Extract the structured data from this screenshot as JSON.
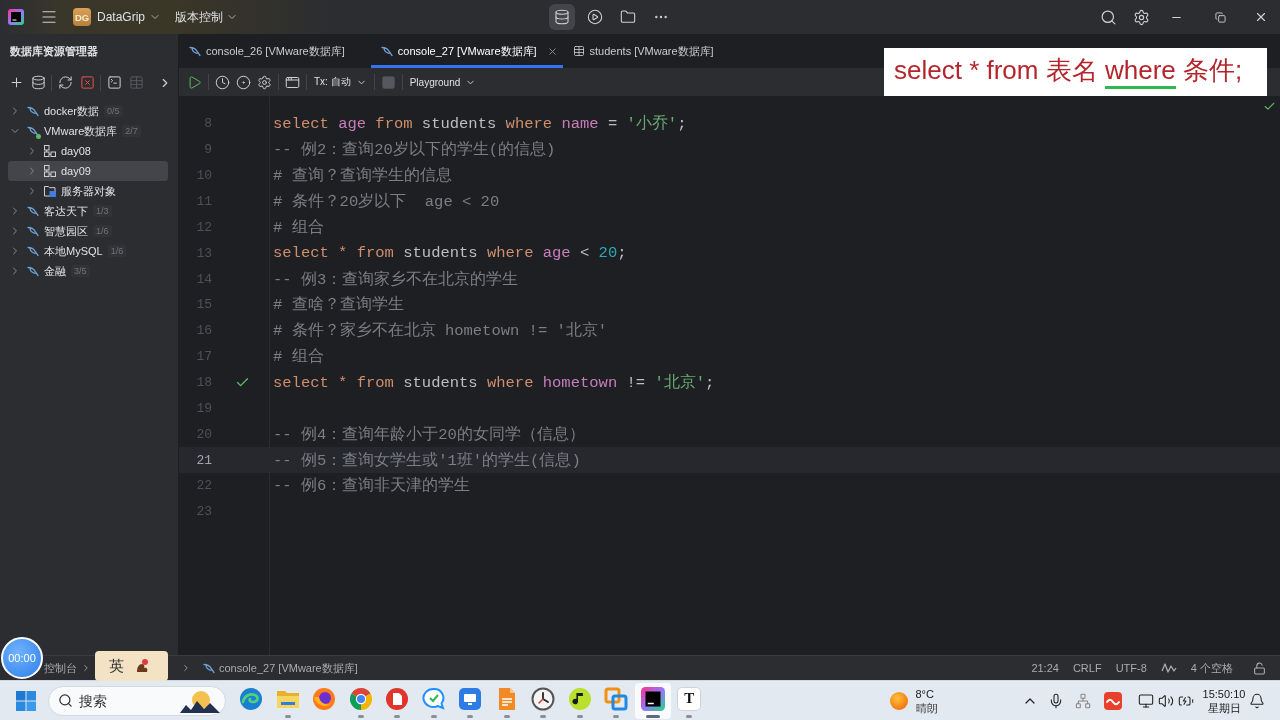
{
  "title_bar": {
    "project": {
      "badge": "DG",
      "name": "DataGrip"
    },
    "vcs_menu": "版本控制",
    "tools": [
      {
        "kind": "database",
        "selected": true
      },
      {
        "kind": "services",
        "selected": false
      },
      {
        "kind": "folder",
        "selected": false
      },
      {
        "kind": "more",
        "selected": false
      }
    ]
  },
  "sidebar": {
    "title": "数据库资源管理器",
    "toolbar": [
      [
        {
          "kind": "add",
          "disabled": false
        },
        {
          "kind": "datasource-settings",
          "disabled": false
        }
      ],
      [
        {
          "kind": "refresh",
          "disabled": false
        },
        {
          "kind": "disconnect",
          "disabled": false
        }
      ],
      [
        {
          "kind": "console",
          "disabled": false
        },
        {
          "kind": "table",
          "disabled": true
        }
      ]
    ],
    "tree": [
      {
        "label": "docker数据",
        "count": "0/5",
        "kind": "datasource",
        "connected": false,
        "expanded": false,
        "selected": false
      },
      {
        "label": "VMware数据库",
        "count": "2/7",
        "kind": "datasource",
        "connected": true,
        "expanded": true,
        "selected": false,
        "children": [
          {
            "label": "day08",
            "kind": "schema",
            "expanded": false,
            "selected": false
          },
          {
            "label": "day09",
            "kind": "schema",
            "expanded": false,
            "selected": true
          },
          {
            "label": "服务器对象",
            "kind": "folder",
            "expanded": false,
            "selected": false
          }
        ]
      },
      {
        "label": "客达天下",
        "count": "1/3",
        "kind": "datasource",
        "connected": false,
        "expanded": false,
        "selected": false
      },
      {
        "label": "智慧园区",
        "count": "1/6",
        "kind": "datasource",
        "connected": false,
        "expanded": false,
        "selected": false
      },
      {
        "label": "本地MySQL",
        "count": "1/6",
        "kind": "datasource",
        "connected": false,
        "expanded": false,
        "selected": false
      },
      {
        "label": "金融",
        "count": "3/5",
        "kind": "datasource",
        "connected": false,
        "expanded": false,
        "selected": false
      }
    ]
  },
  "tabs": [
    {
      "label": "console_26 [VMware数据库]",
      "kind": "console",
      "selected": false
    },
    {
      "label": "console_27 [VMware数据库]",
      "kind": "console",
      "selected": true
    },
    {
      "label": "students [VMware数据库]",
      "kind": "table",
      "selected": false
    }
  ],
  "editor_toolbar": [
    [
      {
        "kind": "run",
        "disabled": false
      }
    ],
    [
      {
        "kind": "history",
        "disabled": false
      },
      {
        "kind": "ddl",
        "disabled": false
      },
      {
        "kind": "settings",
        "disabled": false
      }
    ],
    [
      {
        "kind": "layout",
        "disabled": false
      }
    ],
    [
      {
        "kind": "dropdown",
        "label": "Tx: 自动"
      }
    ],
    [
      {
        "kind": "stop",
        "disabled": true
      }
    ],
    [
      {
        "kind": "dropdown",
        "label": "Playground"
      }
    ]
  ],
  "caption": [
    {
      "text": "select * from 表名 ",
      "underlined": false
    },
    {
      "text": "where",
      "underlined": true
    },
    {
      "text": " 条件;",
      "underlined": false
    }
  ],
  "editor": {
    "inspections_passed": true,
    "lines": [
      {
        "number": "8",
        "current": false,
        "executed": false,
        "tokens": [
          {
            "kind": "keyword",
            "text": "select "
          },
          {
            "kind": "column",
            "text": "age "
          },
          {
            "kind": "keyword",
            "text": "from "
          },
          {
            "kind": "plain",
            "text": "students "
          },
          {
            "kind": "keyword",
            "text": "where "
          },
          {
            "kind": "column",
            "text": "name "
          },
          {
            "kind": "plain",
            "text": "= "
          },
          {
            "kind": "string",
            "text": "'小乔'"
          },
          {
            "kind": "plain",
            "text": ";"
          }
        ]
      },
      {
        "number": "9",
        "current": false,
        "executed": false,
        "tokens": [
          {
            "kind": "comment",
            "text": "-- 例2：查询20岁以下的学生(的信息)"
          }
        ]
      },
      {
        "number": "10",
        "current": false,
        "executed": false,
        "tokens": [
          {
            "kind": "comment",
            "text": "# 查询？查询学生的信息"
          }
        ]
      },
      {
        "number": "11",
        "current": false,
        "executed": false,
        "tokens": [
          {
            "kind": "comment",
            "text": "# 条件？20岁以下  age < 20"
          }
        ]
      },
      {
        "number": "12",
        "current": false,
        "executed": false,
        "tokens": [
          {
            "kind": "comment",
            "text": "# 组合"
          }
        ]
      },
      {
        "number": "13",
        "current": false,
        "executed": false,
        "tokens": [
          {
            "kind": "keyword",
            "text": "select * from "
          },
          {
            "kind": "plain",
            "text": "students "
          },
          {
            "kind": "keyword",
            "text": "where "
          },
          {
            "kind": "column",
            "text": "age "
          },
          {
            "kind": "plain",
            "text": "< "
          },
          {
            "kind": "number",
            "text": "20"
          },
          {
            "kind": "plain",
            "text": ";"
          }
        ]
      },
      {
        "number": "14",
        "current": false,
        "executed": false,
        "tokens": [
          {
            "kind": "comment",
            "text": "-- 例3：查询家乡不在北京的学生"
          }
        ]
      },
      {
        "number": "15",
        "current": false,
        "executed": false,
        "tokens": [
          {
            "kind": "comment",
            "text": "# 查啥？查询学生"
          }
        ]
      },
      {
        "number": "16",
        "current": false,
        "executed": false,
        "tokens": [
          {
            "kind": "comment",
            "text": "# 条件？家乡不在北京 hometown != '北京'"
          }
        ]
      },
      {
        "number": "17",
        "current": false,
        "executed": false,
        "tokens": [
          {
            "kind": "comment",
            "text": "# 组合"
          }
        ]
      },
      {
        "number": "18",
        "current": false,
        "executed": true,
        "tokens": [
          {
            "kind": "keyword",
            "text": "select * from "
          },
          {
            "kind": "plain",
            "text": "students "
          },
          {
            "kind": "keyword",
            "text": "where "
          },
          {
            "kind": "column",
            "text": "hometown "
          },
          {
            "kind": "plain",
            "text": "!= "
          },
          {
            "kind": "string",
            "text": "'北京'"
          },
          {
            "kind": "plain",
            "text": ";"
          }
        ]
      },
      {
        "number": "19",
        "current": false,
        "executed": false
      },
      {
        "number": "20",
        "current": false,
        "executed": false,
        "tokens": [
          {
            "kind": "comment",
            "text": "-- 例4：查询年龄小于20的女同学（信息）"
          }
        ]
      },
      {
        "number": "21",
        "current": true,
        "executed": false,
        "tokens": [
          {
            "kind": "comment",
            "text": "-- 例5：查询女学生或'1班'的学生(信息)"
          }
        ]
      },
      {
        "number": "22",
        "current": false,
        "executed": false,
        "tokens": [
          {
            "kind": "comment",
            "text": "-- 例6：查询非天津的学生"
          }
        ]
      },
      {
        "number": "23",
        "current": false,
        "executed": false
      }
    ]
  },
  "status_bar": {
    "breadcrumbs": [
      {
        "label": "控制台",
        "kind": "plain"
      },
      {
        "label": "console_27 [VMware数据库]",
        "kind": "console"
      }
    ],
    "position": "21:24",
    "line_ending": "CRLF",
    "encoding": "UTF-8",
    "indent": "4 个空格"
  },
  "recording_timer": "00:00",
  "ime_toolbar": {
    "mode": "英"
  },
  "taskbar": {
    "search": {
      "placeholder": "搜索"
    },
    "apps": [
      {
        "kind": "swirl",
        "running": false,
        "active": false
      },
      {
        "kind": "folder",
        "running": true,
        "active": false
      },
      {
        "kind": "fox",
        "running": false,
        "active": false
      },
      {
        "kind": "wheel",
        "running": true,
        "active": false
      },
      {
        "kind": "pdf",
        "running": true,
        "active": false
      },
      {
        "kind": "chat",
        "running": true,
        "active": false
      },
      {
        "kind": "monitor",
        "running": true,
        "active": false
      },
      {
        "kind": "page",
        "running": true,
        "active": false
      },
      {
        "kind": "clock",
        "running": true,
        "active": false
      },
      {
        "kind": "music",
        "running": true,
        "active": false
      },
      {
        "kind": "squares",
        "running": true,
        "active": false
      },
      {
        "kind": "ide",
        "running": true,
        "active": true
      },
      {
        "kind": "letter",
        "label": "T",
        "running": true,
        "active": false
      }
    ],
    "weather": {
      "temperature": "8°C",
      "condition": "晴朗"
    },
    "clock": {
      "time": "15:50:10",
      "day": "星期日"
    }
  }
}
